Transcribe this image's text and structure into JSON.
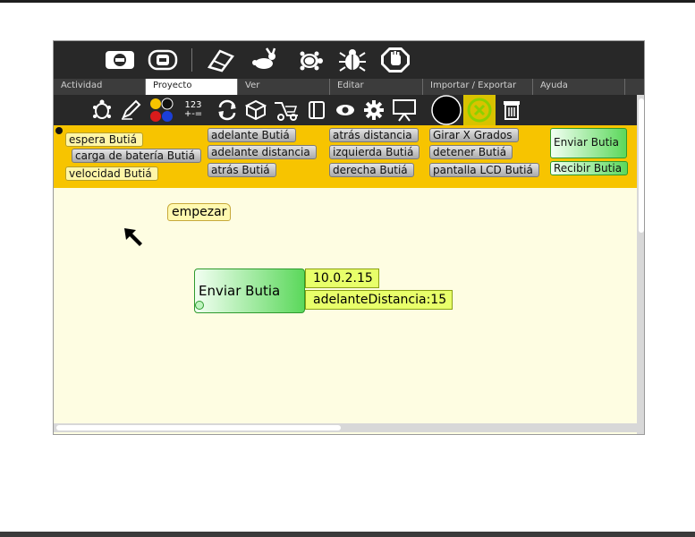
{
  "main_toolbar": {
    "icons": [
      "stop-icon",
      "fullscreen-icon",
      "eraser-icon",
      "rabbit-run-icon",
      "turtle-step-icon",
      "bug-debug-icon",
      "stop-hand-icon"
    ]
  },
  "tabs": [
    {
      "label": "Actividad",
      "active": false
    },
    {
      "label": "Proyecto",
      "active": true
    },
    {
      "label": "Ver",
      "active": false
    },
    {
      "label": "Editar",
      "active": false
    },
    {
      "label": "Importar / Exportar",
      "active": false
    },
    {
      "label": "Ayuda",
      "active": false
    }
  ],
  "palette_toolbar": {
    "icons": [
      "turtle-palette-icon",
      "pen-palette-icon",
      "colors-palette-icon",
      "numbers-palette-icon",
      "flow-palette-icon",
      "blocks-palette-icon",
      "sensors-palette-icon",
      "media-palette-icon",
      "eye-icon",
      "gear-icon",
      "presentation-icon",
      "black-circle-icon",
      "butia-palette-icon",
      "trash-icon"
    ],
    "numbers_label": "123",
    "ops_label": "+-="
  },
  "palette_blocks": {
    "espera": "espera Butiá",
    "carga": "carga de batería Butiá",
    "velocidad": "velocidad Butiá",
    "adelante": "adelante Butiá",
    "adelante_distancia": "adelante distancia",
    "atras": "atrás Butiá",
    "atras_distancia": "atrás distancia",
    "izquierda": "izquierda Butiá",
    "derecha": "derecha Butiá",
    "girar": "Girar X Grados",
    "detener": "detener Butiá",
    "pantalla": "pantalla LCD Butiá",
    "enviar": "Enviar Butia",
    "recibir": "Recibir Butia"
  },
  "canvas": {
    "start_block": "empezar",
    "send_block": "Enviar Butia",
    "arg_ip": "10.0.2.15",
    "arg_command": "adelanteDistancia:15"
  },
  "colors": {
    "toolbar_bg": "#282828",
    "palette_bg": "#f7c400",
    "canvas_bg": "#fefde2",
    "butia_green": "#5bd85b"
  }
}
